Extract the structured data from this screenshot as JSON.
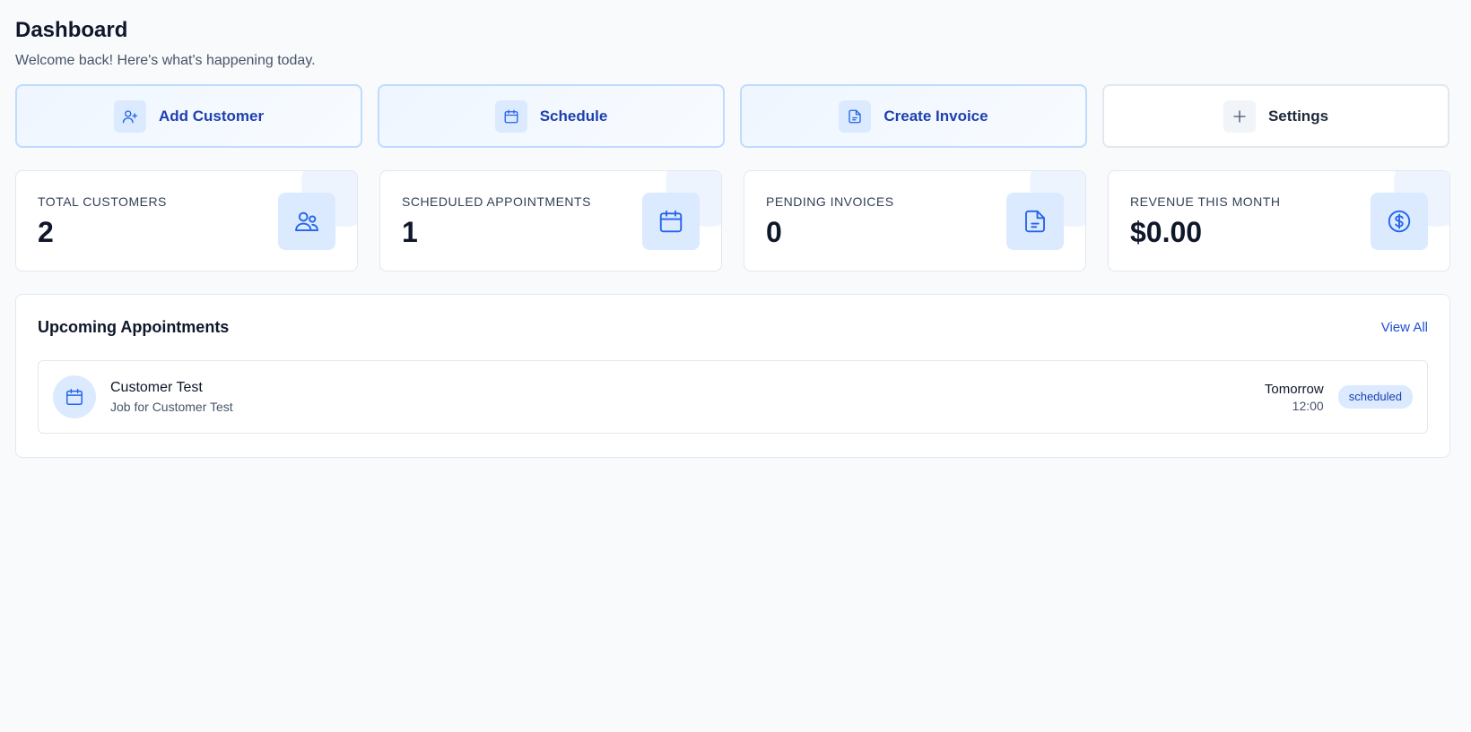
{
  "header": {
    "title": "Dashboard",
    "subtitle": "Welcome back! Here's what's happening today."
  },
  "quick_actions": [
    {
      "label": "Add Customer",
      "icon": "user-plus-icon"
    },
    {
      "label": "Schedule",
      "icon": "calendar-icon"
    },
    {
      "label": "Create Invoice",
      "icon": "file-text-icon"
    },
    {
      "label": "Settings",
      "icon": "plus-icon"
    }
  ],
  "stats": [
    {
      "label": "TOTAL CUSTOMERS",
      "value": "2",
      "icon": "users-icon"
    },
    {
      "label": "SCHEDULED APPOINTMENTS",
      "value": "1",
      "icon": "calendar-icon"
    },
    {
      "label": "PENDING INVOICES",
      "value": "0",
      "icon": "file-text-icon"
    },
    {
      "label": "REVENUE THIS MONTH",
      "value": "$0.00",
      "icon": "dollar-circle-icon"
    }
  ],
  "appointments": {
    "title": "Upcoming Appointments",
    "view_all_label": "View All",
    "items": [
      {
        "name": "Customer Test",
        "description": "Job for Customer Test",
        "day": "Tomorrow",
        "time": "12:00",
        "status": "scheduled",
        "icon": "calendar-icon"
      }
    ]
  },
  "colors": {
    "accent": "#1d4ed8",
    "accent_light": "#dbeafe",
    "background": "#f8fafc",
    "border": "#e2e8f0"
  }
}
